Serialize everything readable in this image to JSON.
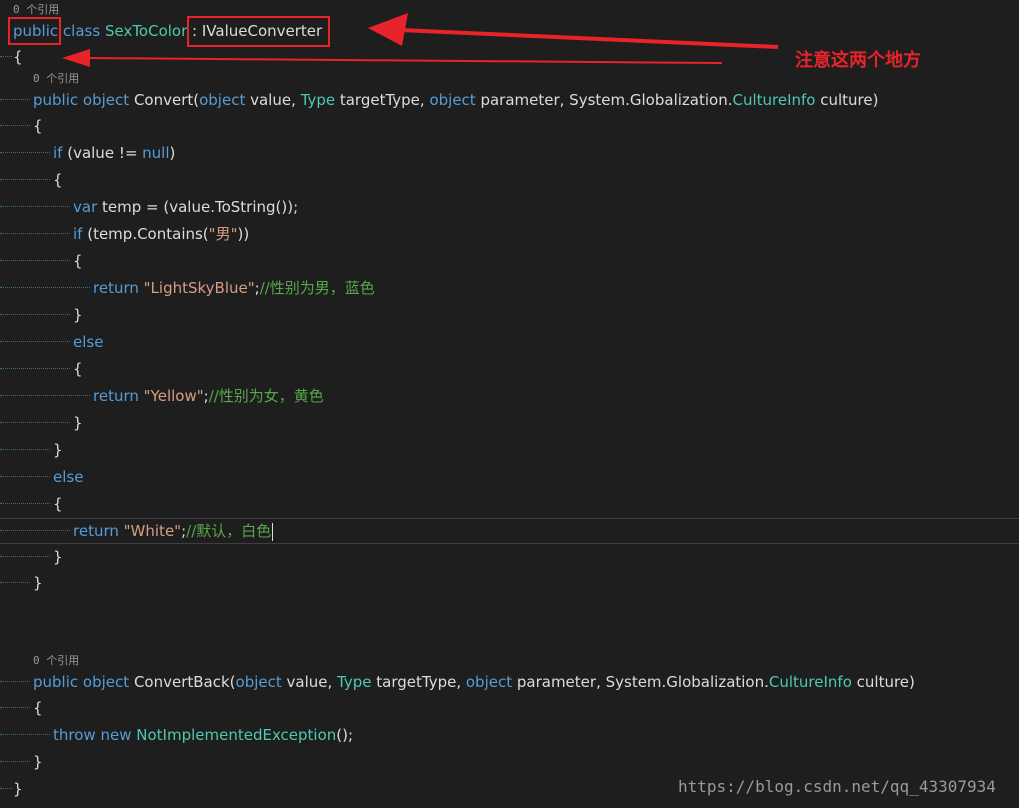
{
  "code_lens": {
    "class_refs": "0 个引用",
    "convert_refs": "0 个引用",
    "convertback_refs": "0 个引用"
  },
  "code": {
    "class_decl": {
      "public": "public",
      "class": "class",
      "name": "SexToColor",
      "colon": " : ",
      "interface": "IValueConverter"
    },
    "open_class": "{",
    "convert_sig": {
      "public": "public",
      "object": "object",
      "name": "Convert(",
      "p1_type": "object",
      "p1_name": " value, ",
      "p2_type": "Type",
      "p2_name": " targetType, ",
      "p3_type": "object",
      "p3_name": " parameter, System.Globalization.",
      "p4_type": "CultureInfo",
      "p4_name": " culture)"
    },
    "open_convert": "{",
    "if_null": {
      "if": "if",
      "mid": " (value != ",
      "null": "null",
      "end": ")"
    },
    "open_if": "{",
    "var_line": {
      "var": "var",
      "rest": " temp = (value.ToString());"
    },
    "if_contains": {
      "if": "if",
      "pre": " (temp.Contains(",
      "str": "\"男\"",
      "post": "))"
    },
    "open_inner": "{",
    "return_blue": {
      "return": "return",
      "str": "\"LightSkyBlue\"",
      "semi": ";",
      "comment": "//性别为男，蓝色"
    },
    "close_inner": "}",
    "else_inner": "else",
    "open_else_inner": "{",
    "return_yellow": {
      "return": "return",
      "str": "\"Yellow\"",
      "semi": ";",
      "comment": "//性别为女，黄色"
    },
    "close_else_inner": "}",
    "close_if": "}",
    "else_outer": "else",
    "open_else_outer": "{",
    "return_white": {
      "return": "return",
      "str": "\"White\"",
      "semi": ";",
      "comment": "//默认，白色"
    },
    "close_else_outer": "}",
    "close_convert": "}",
    "convertback_sig": {
      "public": "public",
      "object": "object",
      "name": "ConvertBack(",
      "p1_type": "object",
      "p1_name": " value, ",
      "p2_type": "Type",
      "p2_name": " targetType, ",
      "p3_type": "object",
      "p3_name": " parameter, System.Globalization.",
      "p4_type": "CultureInfo",
      "p4_name": " culture)"
    },
    "open_convertback": "{",
    "throw_line": {
      "throw": "throw",
      "new": "new",
      "type": "NotImplementedException",
      "end": "();"
    },
    "close_convertback": "}",
    "close_class": "}"
  },
  "annotation": {
    "text": "注意这两个地方"
  },
  "watermark": "https://blog.csdn.net/qq_43307934",
  "colors": {
    "background": "#1e1e1e",
    "keyword": "#569cd6",
    "type": "#4ec9b0",
    "string": "#d69d85",
    "comment": "#57a64a",
    "annotation_red": "#e8232a"
  }
}
